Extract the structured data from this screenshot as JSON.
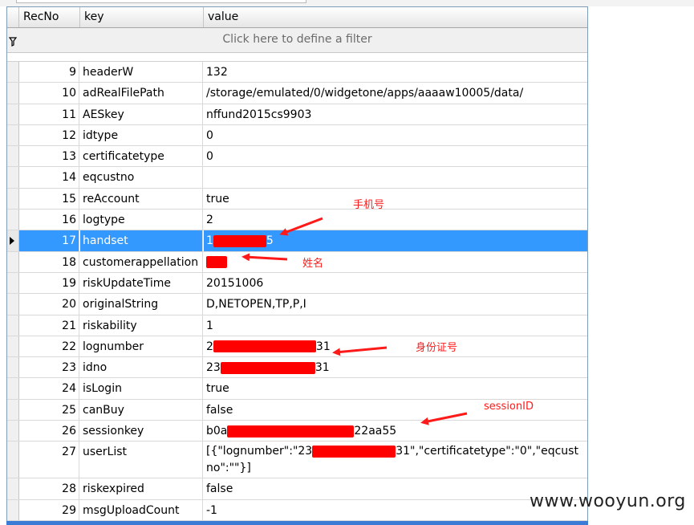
{
  "grid": {
    "columns": [
      "RecNo",
      "key",
      "value"
    ],
    "filter_text": "Click here to define a filter",
    "rows": [
      {
        "recno": "9",
        "key": "headerW",
        "value": "132"
      },
      {
        "recno": "10",
        "key": "adRealFilePath",
        "value": "/storage/emulated/0/widgetone/apps/aaaaw10005/data/"
      },
      {
        "recno": "11",
        "key": "AESkey",
        "value": "nffund2015cs9903"
      },
      {
        "recno": "12",
        "key": "idtype",
        "value": "0"
      },
      {
        "recno": "13",
        "key": "certificatetype",
        "value": "0"
      },
      {
        "recno": "14",
        "key": "eqcustno",
        "value": ""
      },
      {
        "recno": "15",
        "key": "reAccount",
        "value": "true"
      },
      {
        "recno": "16",
        "key": "logtype",
        "value": "2"
      },
      {
        "recno": "17",
        "key": "handset",
        "value_prefix": "1",
        "value_suffix": "5"
      },
      {
        "recno": "18",
        "key": "customerappellation",
        "value_prefix": "",
        "value_suffix": ""
      },
      {
        "recno": "19",
        "key": "riskUpdateTime",
        "value": "20151006"
      },
      {
        "recno": "20",
        "key": "originalString",
        "value": "D,NETOPEN,TP,P,I"
      },
      {
        "recno": "21",
        "key": "riskability",
        "value": "1"
      },
      {
        "recno": "22",
        "key": "lognumber",
        "value_prefix": "2",
        "value_suffix": "31"
      },
      {
        "recno": "23",
        "key": "idno",
        "value_prefix": "23",
        "value_suffix": "31"
      },
      {
        "recno": "24",
        "key": "isLogin",
        "value": "true"
      },
      {
        "recno": "25",
        "key": "canBuy",
        "value": "false"
      },
      {
        "recno": "26",
        "key": "sessionkey",
        "value_prefix": "b0a",
        "value_suffix": "22aa55"
      },
      {
        "recno": "27",
        "key": "userList",
        "value_prefix": "[{\"lognumber\":\"23",
        "value_suffix": "31\",\"certificatetype\":\"0\",\"eqcustno\":\"\"}]"
      },
      {
        "recno": "28",
        "key": "riskexpired",
        "value": "false"
      },
      {
        "recno": "29",
        "key": "msgUploadCount",
        "value": "-1"
      }
    ]
  },
  "annotations": {
    "phone": "手机号",
    "name": "姓名",
    "idcard": "身份证号",
    "session": "sessionID"
  },
  "watermark": "www.wooyun.org",
  "colors": {
    "selection": "#3399ff",
    "annotation": "#ff0000",
    "grid_border": "#7f9db9"
  }
}
